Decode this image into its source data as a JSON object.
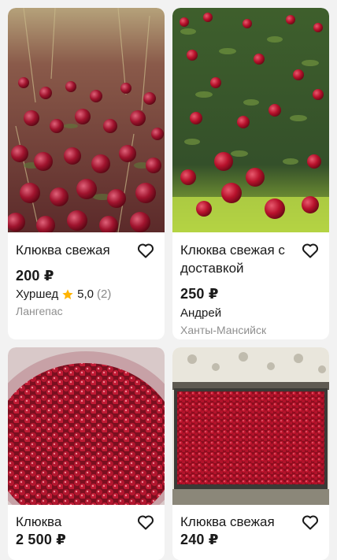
{
  "listings": [
    {
      "title": "Клюква свежая",
      "price": "200 ₽",
      "seller": "Хуршед",
      "rating": "5,0",
      "reviews": "(2)",
      "city": "Лангепас"
    },
    {
      "title": "Клюква свежая с доставкой",
      "price": "250 ₽",
      "seller": "Андрей",
      "rating": "",
      "reviews": "",
      "city": "Ханты-Мансийск"
    },
    {
      "title": "Клюква",
      "price": "2 500 ₽"
    },
    {
      "title": "Клюква свежая",
      "price": "240 ₽"
    }
  ],
  "colors": {
    "background": "#f2f2f2",
    "card": "#ffffff",
    "star": "#ffb400",
    "muted": "#8f8f8f",
    "berry": "#a4122d"
  },
  "icons": {
    "favorite": "heart-outline-icon",
    "rating": "star-icon"
  }
}
